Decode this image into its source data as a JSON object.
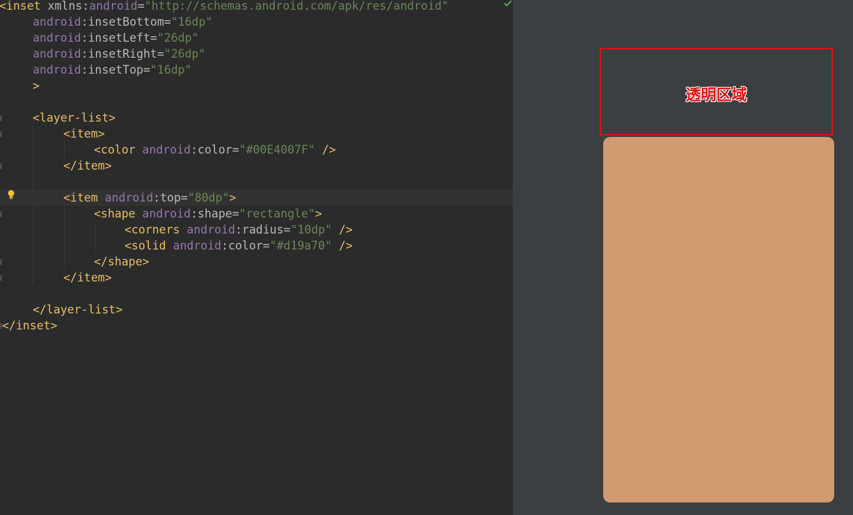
{
  "editor": {
    "lines": [
      {
        "tag_open": "<inset",
        "sp1": " ",
        "attr": "xmlns",
        "colon": ":",
        "ns": "android",
        "eq": "=",
        "val": "\"http://schemas.android.com/apk/res/android\""
      },
      {
        "ns": "android",
        "colon": ":",
        "attr": "insetBottom",
        "eq": "=",
        "val": "\"16dp\""
      },
      {
        "ns": "android",
        "colon": ":",
        "attr": "insetLeft",
        "eq": "=",
        "val": "\"26dp\""
      },
      {
        "ns": "android",
        "colon": ":",
        "attr": "insetRight",
        "eq": "=",
        "val": "\"26dp\""
      },
      {
        "ns": "android",
        "colon": ":",
        "attr": "insetTop",
        "eq": "=",
        "val": "\"16dp\""
      },
      {
        "tag": ">"
      },
      {
        "tag": ""
      },
      {
        "tag": "<layer-list>"
      },
      {
        "tag": "<item>"
      },
      {
        "tag_open": "<color",
        "sp1": " ",
        "ns": "android",
        "colon": ":",
        "attr": "color",
        "eq": "=",
        "val": "\"#00E4007F\"",
        "tag_close": " />"
      },
      {
        "tag": "</item>"
      },
      {
        "tag": ""
      },
      {
        "tag_open": "<item",
        "sp1": " ",
        "ns": "android",
        "colon": ":",
        "attr": "top",
        "eq": "=",
        "val": "\"80dp\"",
        "tag_close": ">"
      },
      {
        "tag_open": "<shape",
        "sp1": " ",
        "ns": "android",
        "colon": ":",
        "attr": "shape",
        "eq": "=",
        "val": "\"rectangle\"",
        "tag_close": ">"
      },
      {
        "tag_open": "<corners",
        "sp1": " ",
        "ns": "android",
        "colon": ":",
        "attr": "radius",
        "eq": "=",
        "val": "\"10dp\"",
        "tag_close": " />"
      },
      {
        "tag_open": "<solid",
        "sp1": " ",
        "ns": "android",
        "colon": ":",
        "attr": "color",
        "eq": "=",
        "val": "\"#d19a70\"",
        "tag_close": " />"
      },
      {
        "tag": "</shape>"
      },
      {
        "tag": "</item>"
      },
      {
        "tag": ""
      },
      {
        "tag": "</layer-list>"
      },
      {
        "tag": "</inset>"
      }
    ]
  },
  "preview": {
    "region_label": "透明区域",
    "shape_color": "#d19a70",
    "border_color": "#e01010",
    "background": "#3c3f41"
  },
  "colors": {
    "editor_bg": "#2b2b2b",
    "tag": "#e8bf6a",
    "namespace": "#9876aa",
    "attribute": "#bababa",
    "value": "#6a8759"
  }
}
